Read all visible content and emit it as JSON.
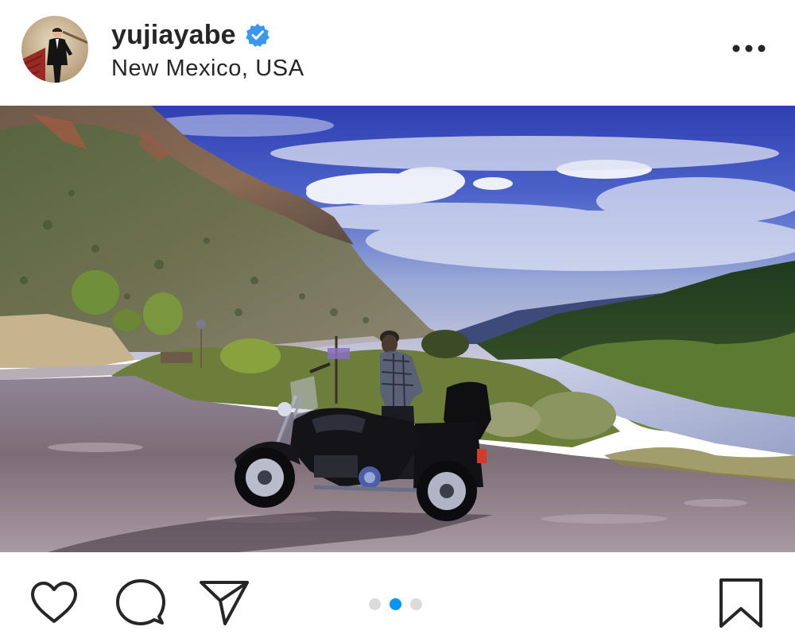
{
  "post": {
    "username": "yujiayabe",
    "location": "New Mexico, USA",
    "verified": true,
    "carousel": {
      "count": 3,
      "active_index": 1
    }
  },
  "icons": {
    "verified": "verified-badge-icon",
    "more": "more-options-icon",
    "like": "heart-icon",
    "comment": "comment-bubble-icon",
    "share": "paper-plane-icon",
    "save": "bookmark-icon"
  },
  "colors": {
    "text": "#262626",
    "verified_badge": "#3897f0",
    "carousel_active": "#0095f6",
    "carousel_inactive": "#dbdbdb"
  }
}
